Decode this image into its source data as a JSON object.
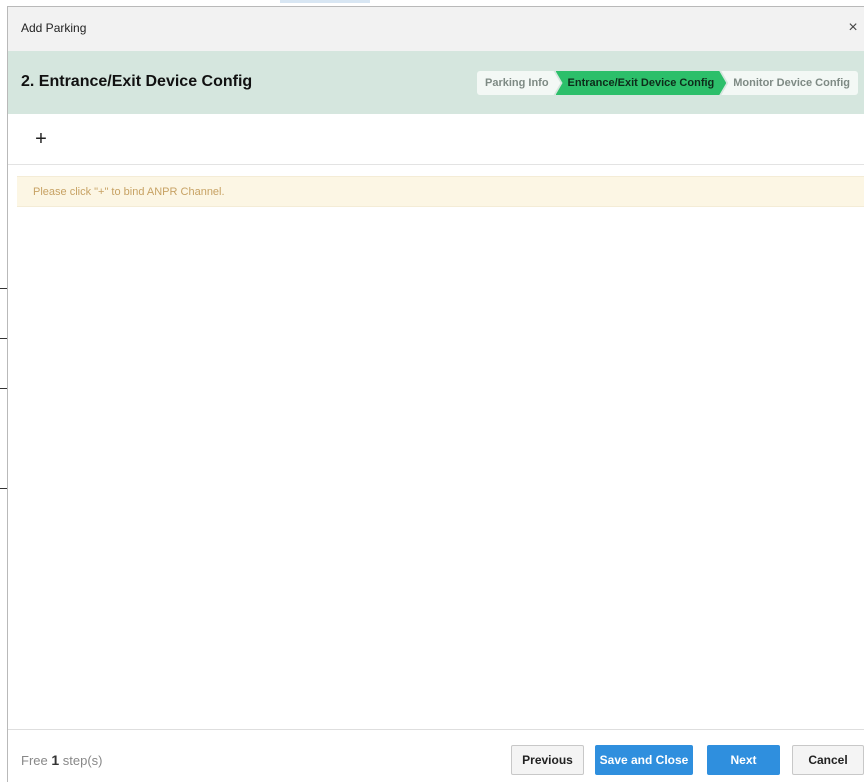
{
  "dialog": {
    "title": "Add Parking",
    "close_symbol": "×"
  },
  "stepbar": {
    "current_step_title": "2. Entrance/Exit Device Config",
    "steps": [
      {
        "label": "Parking Info",
        "state": "done"
      },
      {
        "label": "Entrance/Exit Device Config",
        "state": "active"
      },
      {
        "label": "Monitor Device Config",
        "state": "pending"
      }
    ]
  },
  "toolbar": {
    "add_symbol": "+"
  },
  "hint": {
    "text": "Please click \"+\" to bind ANPR Channel."
  },
  "footer": {
    "free_label": "Free",
    "free_count": "1",
    "free_suffix": "step(s)",
    "previous_label": "Previous",
    "save_close_label": "Save and Close",
    "next_label": "Next",
    "cancel_label": "Cancel"
  },
  "colors": {
    "stepbar_bg": "#d5e6de",
    "active_step": "#2cbf6a",
    "primary_button": "#2f8fde",
    "hint_bg": "#fcf6e4",
    "hint_text": "#c7a264"
  },
  "icons": {
    "close": "close-icon",
    "add": "plus-icon"
  }
}
